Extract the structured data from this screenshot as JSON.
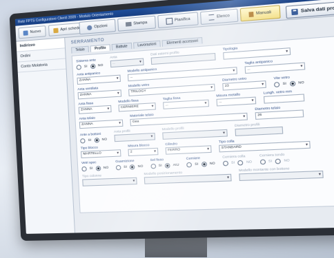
{
  "window": {
    "title": "Rete FPTS Configuratore Clienti 2009 - Modulo Orientamento"
  },
  "toolbar": {
    "new_label": "Nuovo",
    "open_label": "Apri schede",
    "tabs": [
      {
        "label": "Opzioni",
        "icon": "settings-icon",
        "active": false
      },
      {
        "label": "Stampa",
        "icon": "printer-icon",
        "active": false
      },
      {
        "label": "Pianifica",
        "icon": "calendar-icon",
        "active": false
      },
      {
        "label": "Elenco",
        "icon": "list-icon",
        "active": false
      },
      {
        "label": "Manuali",
        "icon": "book-icon",
        "active": true
      }
    ],
    "save_label": "Salva dati profilo"
  },
  "sidebar": {
    "items": [
      {
        "label": "Indirizzo",
        "active": true
      },
      {
        "label": "Ordini",
        "active": false
      },
      {
        "label": "Conto Molatoria",
        "active": false
      }
    ]
  },
  "main": {
    "section_title": "SERRAMENTO",
    "subtabs": [
      {
        "label": "Telaio",
        "active": false
      },
      {
        "label": "Profilo",
        "active": true
      },
      {
        "label": "Battute",
        "active": false
      },
      {
        "label": "Lavorazioni",
        "active": false
      },
      {
        "label": "Elementi accessori",
        "active": false
      }
    ],
    "fields": {
      "tipologia_label": "Tipologia",
      "sistema_label": "Sistema ante",
      "sistema_no": "NO",
      "sistema_si": "SI",
      "anta_label": "Anta",
      "anta_value": "...",
      "dati_esterni_label": "Dati esterni profilo",
      "anta_ante_label": "Anta antipanico",
      "anta_ante_value": "ZANNA",
      "modello_anta_label": "Modello antipanico",
      "modello_anta_value": "...",
      "taglia_label": "Taglia antipanico",
      "taglia_value": "...",
      "anta_ventilata_label": "Anta ventilata",
      "anta_ventilata_value": "ZANNA",
      "modello_vetro_label": "Modello vetro",
      "modello_vetro_value": "TRILOGY",
      "diametro_vetro_label": "Diametro vetro",
      "diametro_vetro_value": "23",
      "vite_vetro_label": "Vite vetro",
      "vite_si": "SI",
      "vite_no": "NO",
      "anta_fissa_label": "Anta fissa",
      "anta_fissa_value": "ZANNA",
      "modello_fissa_label": "Modello fissa",
      "modello_fissa_value": "CERNIERE",
      "taglia_fissa_label": "Taglia fissa",
      "taglia_fissa_value": "...",
      "misura_label": "Misura metallo",
      "misura_value": "...",
      "lunghezza_label": "Lungh. vetro mm",
      "lunghezza_value": "",
      "anta_telaio_label": "Anta telaio",
      "anta_telaio_value": "ZANNA",
      "materiale_label": "Materiale telaio",
      "materiale_value": "Gea",
      "diametro_telaio_label": "Diametro telaio",
      "diametro_telaio_value": "26",
      "anta_bottoni_label": "Ante a bottoni",
      "bottoni_si": "SI",
      "bottoni_no": "NO",
      "anta_profili_label": "Anta profili",
      "modello_profili_label": "Modello profili",
      "diametro_profili_label": "Diametro profili",
      "tipo_blocco_label": "Tipo blocco",
      "tipo_blocco_value": "MARTELLO",
      "misura_blocco_label": "Misura blocco",
      "misura_blocco_value": "2",
      "cilindro_label": "Cilindro",
      "cilindro_value": "FERRO",
      "tipo_colla_label": "Tipo colla",
      "tipo_colla_value": "STANDARD",
      "vetri_label": "Vetri spec",
      "vetri_si": "SI",
      "vetri_no": "NO",
      "guarnizione_label": "Guarnizione",
      "guarnizione_si": "SI",
      "guarnizione_no": "NO",
      "sel_fisso_label": "Sel fisso",
      "sel_si": "SI",
      "sel_aiu": "AIU",
      "cerniere_label": "Cerniere",
      "cerniere_si": "SI",
      "cerniere_no": "NO",
      "cerniera_colla_label": "Cerniera colla",
      "cerniera_colla_si": "SI",
      "cerniera_colla_no": "NO",
      "cerniera_tondo_label": "Cerniera tondo",
      "cerniera_tondo_si": "SI",
      "cerniera_tondo_no": "NO",
      "tipo_colonne_label": "Tipo colonne",
      "modello_colonne_label": "Modello posizionamento",
      "modello_montante_label": "Modello montante con bottone"
    }
  }
}
